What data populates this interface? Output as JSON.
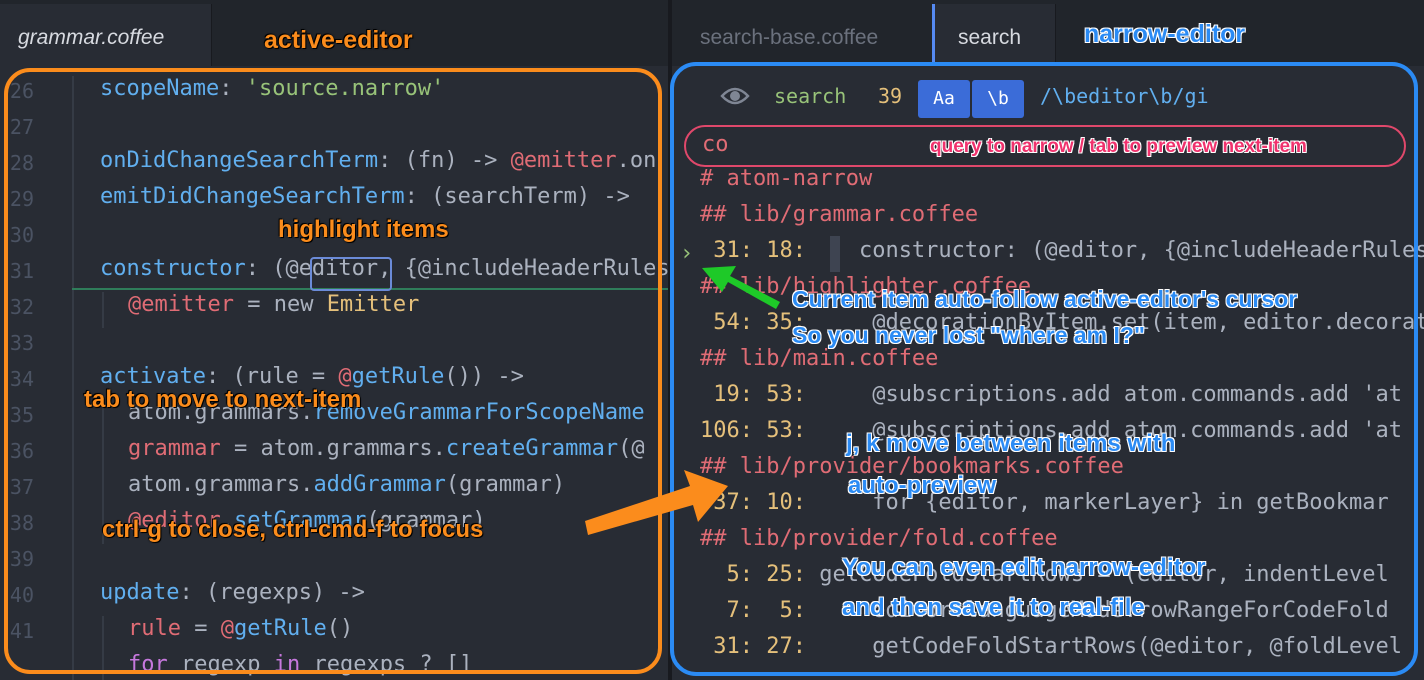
{
  "tabs": {
    "left_tab": "grammar.coffee",
    "right_tab_inactive": "search-base.coffee",
    "right_tab_active": "search"
  },
  "left_editor": {
    "line_numbers": [
      "26",
      "27",
      "28",
      "29",
      "30",
      "31",
      "32",
      "33",
      "34",
      "35",
      "36",
      "37",
      "38",
      "39",
      "40",
      "41"
    ],
    "lines": [
      {
        "indent": 1,
        "parts": [
          [
            "fn",
            "scopeName"
          ],
          [
            "op",
            ": "
          ],
          [
            "str",
            "'source.narrow'"
          ]
        ]
      },
      {
        "indent": 1,
        "parts": []
      },
      {
        "indent": 1,
        "parts": [
          [
            "fn",
            "onDidChangeSearchTerm"
          ],
          [
            "op",
            ": (fn) -> "
          ],
          [
            "vr",
            "@emitter"
          ],
          [
            "op",
            ".on"
          ]
        ]
      },
      {
        "indent": 1,
        "parts": [
          [
            "fn",
            "emitDidChangeSearchTerm"
          ],
          [
            "op",
            ": (searchTerm) -> "
          ]
        ]
      },
      {
        "indent": 1,
        "parts": []
      },
      {
        "indent": 1,
        "parts": [
          [
            "fn",
            "constructor"
          ],
          [
            "op",
            ": (@"
          ],
          [
            "op",
            "editor"
          ],
          [
            "op",
            ", {@includeHeaderRules"
          ]
        ]
      },
      {
        "indent": 2,
        "parts": [
          [
            "vr",
            "@emitter"
          ],
          [
            "op",
            " = new "
          ],
          [
            "cls",
            "Emitter"
          ]
        ]
      },
      {
        "indent": 1,
        "parts": []
      },
      {
        "indent": 1,
        "parts": [
          [
            "fn",
            "activate"
          ],
          [
            "op",
            ": (rule = "
          ],
          [
            "vr",
            "@"
          ],
          [
            "fn",
            "getRule"
          ],
          [
            "op",
            "()) ->"
          ]
        ]
      },
      {
        "indent": 2,
        "parts": [
          [
            "op",
            "atom.grammars."
          ],
          [
            "fn",
            "removeGrammarForScopeName"
          ]
        ]
      },
      {
        "indent": 2,
        "parts": [
          [
            "vr",
            "grammar"
          ],
          [
            "op",
            " = atom.grammars."
          ],
          [
            "fn",
            "createGrammar"
          ],
          [
            "op",
            "(@"
          ]
        ]
      },
      {
        "indent": 2,
        "parts": [
          [
            "op",
            "atom.grammars."
          ],
          [
            "fn",
            "addGrammar"
          ],
          [
            "op",
            "(grammar)"
          ]
        ]
      },
      {
        "indent": 2,
        "parts": [
          [
            "vr",
            "@editor"
          ],
          [
            "op",
            "."
          ],
          [
            "fn",
            "setGrammar"
          ],
          [
            "op",
            "(grammar)"
          ]
        ]
      },
      {
        "indent": 1,
        "parts": []
      },
      {
        "indent": 1,
        "parts": [
          [
            "fn",
            "update"
          ],
          [
            "op",
            ": (regexps) ->"
          ]
        ]
      },
      {
        "indent": 2,
        "parts": [
          [
            "vr",
            "rule"
          ],
          [
            "op",
            " = "
          ],
          [
            "vr",
            "@"
          ],
          [
            "fn",
            "getRule"
          ],
          [
            "op",
            "()"
          ]
        ]
      },
      {
        "indent": 2,
        "parts": [
          [
            "kw",
            "for"
          ],
          [
            "op",
            " regexp "
          ],
          [
            "kw",
            "in"
          ],
          [
            "op",
            " regexps ? []"
          ]
        ]
      }
    ]
  },
  "narrow": {
    "prompt_label": "search",
    "match_count": "39",
    "toggle_case": "Aa",
    "toggle_word": "\\b",
    "regex": "/\\beditor\\b/gi",
    "query": "co",
    "items": [
      {
        "kind": "hdr",
        "text": "# atom-narrow"
      },
      {
        "kind": "hdr",
        "text": "## lib/grammar.coffee"
      },
      {
        "kind": "item",
        "loc": " 31: 18: ",
        "text": "   constructor: (@editor, {@includeHeaderRules"
      },
      {
        "kind": "hdr",
        "text": "## lib/highlighter.coffee"
      },
      {
        "kind": "item",
        "loc": " 54: 35: ",
        "text": "    @decorationByItem.set(item, editor.decorate"
      },
      {
        "kind": "hdr",
        "text": "## lib/main.coffee"
      },
      {
        "kind": "item",
        "loc": " 19: 53: ",
        "text": "    @subscriptions.add atom.commands.add 'at"
      },
      {
        "kind": "item",
        "loc": "106: 53: ",
        "text": "    @subscriptions.add atom.commands.add 'at"
      },
      {
        "kind": "hdr",
        "text": "## lib/provider/bookmarks.coffee"
      },
      {
        "kind": "item",
        "loc": " 37: 10: ",
        "text": "    for {editor, markerLayer} in getBookmar"
      },
      {
        "kind": "hdr",
        "text": "## lib/provider/fold.coffee"
      },
      {
        "kind": "item",
        "loc": "  5: 25: ",
        "text": "getCodeFoldStartRows = (editor, indentLevel"
      },
      {
        "kind": "item",
        "loc": "  7:  5: ",
        "text": "    editor.languageMode.rowRangeForCodeFold"
      },
      {
        "kind": "item",
        "loc": " 31: 27: ",
        "text": "    getCodeFoldStartRows(@editor, @foldLevel"
      }
    ]
  },
  "annotations": {
    "active_editor": "active-editor",
    "narrow_editor": "narrow-editor",
    "highlight_items": "highlight items",
    "tab_next": "tab  to move to next-item",
    "ctrl_g": "ctrl-g to close, ctrl-cmd-f to focus",
    "query_hint": "query to narrow / tab to preview next-item",
    "auto_follow_1": "Current item auto-follow active-editor's cursor",
    "auto_follow_2": "So you never lost \"where am I?\"",
    "jk_1": "j, k move between items with",
    "jk_2": "auto-preview",
    "edit_1": "You can even edit narrow-editor",
    "edit_2": "and then save it to real-file"
  },
  "colors": {
    "orange": "#fb8c1c",
    "blue": "#2b8bf4",
    "pink": "#f0326d",
    "green": "#1ec928"
  }
}
